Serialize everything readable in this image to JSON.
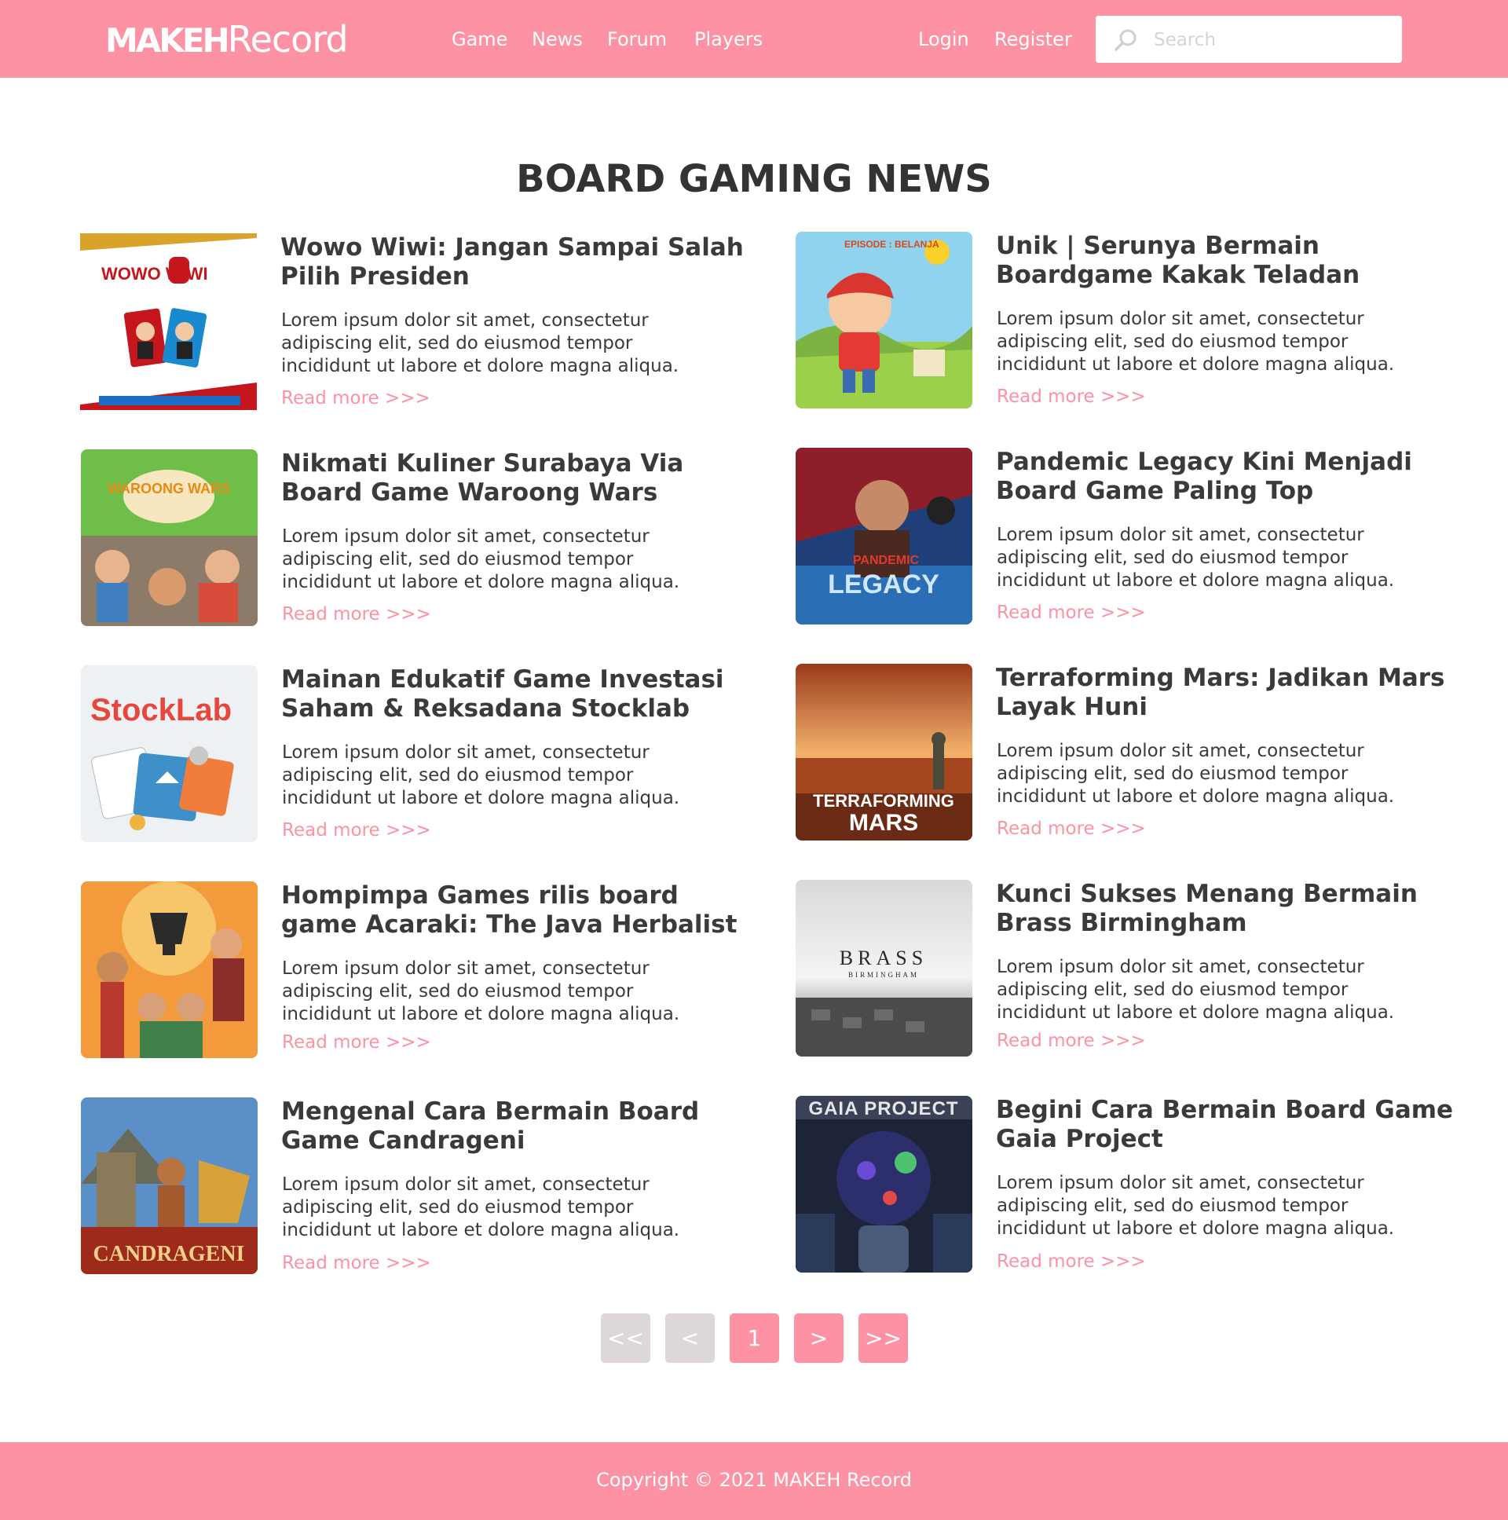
{
  "header": {
    "logo_bold": "MAKEH",
    "logo_light": "Record",
    "nav": [
      "Game",
      "News",
      "Forum",
      "Players"
    ],
    "auth": [
      "Login",
      "Register"
    ],
    "search_placeholder": "Search"
  },
  "section_title": "BOARD GAMING NEWS",
  "articles": [
    {
      "title": "Wowo Wiwi: Jangan Sampai Salah Pilih Presiden",
      "excerpt": "Lorem ipsum dolor sit amet, consectetur adipiscing elit, sed do eiusmod tempor incididunt ut labore et dolore magna aliqua.",
      "link": "Read more >>>",
      "image_label": "WOWO WIWI"
    },
    {
      "title": "Unik | Serunya Bermain Boardgame Kakak Teladan",
      "excerpt": "Lorem ipsum dolor sit amet, consectetur adipiscing elit, sed do eiusmod tempor incididunt ut labore et dolore magna aliqua.",
      "link": "Read more >>>",
      "image_label": "EPISODE : BELANJA"
    },
    {
      "title": "Nikmati Kuliner Surabaya Via Board Game Waroong Wars",
      "excerpt": "Lorem ipsum dolor sit amet, consectetur adipiscing elit, sed do eiusmod tempor incididunt ut labore et dolore magna aliqua.",
      "link": "Read more >>>",
      "image_label": "WAROONG WARS"
    },
    {
      "title": "Pandemic Legacy Kini Menjadi Board Game Paling Top",
      "excerpt": "Lorem ipsum dolor sit amet, consectetur adipiscing elit, sed do eiusmod tempor incididunt ut labore et dolore magna aliqua.",
      "link": "Read more >>>",
      "image_label": "PANDEMIC LEGACY"
    },
    {
      "title": "Mainan Edukatif Game Investasi Saham & Reksadana Stocklab",
      "excerpt": "Lorem ipsum dolor sit amet, consectetur adipiscing elit, sed do eiusmod tempor incididunt ut labore et dolore magna aliqua.",
      "link": "Read more >>>",
      "image_label": "StockLab"
    },
    {
      "title": "Terraforming Mars: Jadikan Mars Layak Huni",
      "excerpt": "Lorem ipsum dolor sit amet, consectetur adipiscing elit, sed do eiusmod tempor incididunt ut labore et dolore magna aliqua.",
      "link": "Read more >>>",
      "image_label": "TERRAFORMING MARS"
    },
    {
      "title": "Hompimpa Games rilis board game Acaraki: The Java Herbalist",
      "excerpt": "Lorem ipsum dolor sit amet, consectetur adipiscing elit, sed do eiusmod tempor incididunt ut labore et dolore magna aliqua.",
      "link": "Read more >>>",
      "image_label": ""
    },
    {
      "title": "Kunci Sukses Menang Bermain Brass Birmingham",
      "excerpt": "Lorem ipsum dolor sit amet, consectetur adipiscing elit, sed do eiusmod tempor incididunt ut labore et dolore magna aliqua.",
      "link": "Read more >>>",
      "image_label": "BRASS"
    },
    {
      "title": "Mengenal Cara Bermain Board Game Candrageni",
      "excerpt": "Lorem ipsum dolor sit amet, consectetur adipiscing elit, sed do eiusmod tempor incididunt ut labore et dolore magna aliqua.",
      "link": "Read more >>>",
      "image_label": "CANDRAGENI"
    },
    {
      "title": "Begini Cara Bermain Board Game Gaia Project",
      "excerpt": "Lorem ipsum dolor sit amet, consectetur adipiscing elit, sed do eiusmod tempor incididunt ut labore et dolore magna aliqua.",
      "link": "Read more >>>",
      "image_label": "GAIA PROJECT"
    }
  ],
  "pagination": {
    "first": "<<",
    "prev": "<",
    "current": "1",
    "next": ">",
    "last": ">>"
  },
  "footer": {
    "copyright": "Copyright © 2021 MAKEH Record"
  },
  "colors": {
    "brand": "#fe92a5",
    "pager_disabled": "#ddd7d8",
    "text": "#333333"
  }
}
